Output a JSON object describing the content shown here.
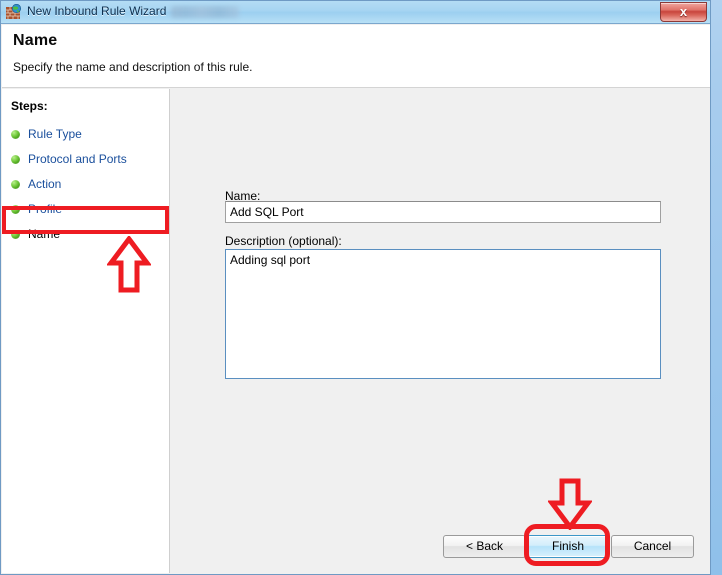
{
  "window": {
    "title": "New Inbound Rule Wizard",
    "title_icon": "firewall-brick-globe-icon",
    "close_label": "x"
  },
  "header": {
    "title": "Name",
    "subtitle": "Specify the name and description of this rule."
  },
  "sidebar": {
    "label": "Steps:",
    "items": [
      {
        "label": "Rule Type",
        "state": "completed"
      },
      {
        "label": "Protocol and Ports",
        "state": "completed"
      },
      {
        "label": "Action",
        "state": "completed"
      },
      {
        "label": "Profile",
        "state": "completed"
      },
      {
        "label": "Name",
        "state": "current"
      }
    ]
  },
  "form": {
    "name_label": "Name:",
    "name_value": "Add SQL Port",
    "name_placeholder": "",
    "description_label": "Description (optional):",
    "description_value": "Adding sql port",
    "description_placeholder": ""
  },
  "footer": {
    "back_label": "< Back",
    "finish_label": "Finish",
    "cancel_label": "Cancel"
  },
  "annotations": {
    "color": "#ee1c22",
    "step_highlight_target": "Name",
    "button_highlight_target": "Finish",
    "arrow_up_name": "red-arrow-up",
    "arrow_down_name": "red-arrow-down"
  },
  "colors": {
    "accent_blue": "#1a4f9c",
    "titlebar_blue": "#a7d5f2",
    "annotation_red": "#ee1c22",
    "default_button_blue": "#b5e2fa",
    "step_bullet_green": "#3f9612"
  }
}
